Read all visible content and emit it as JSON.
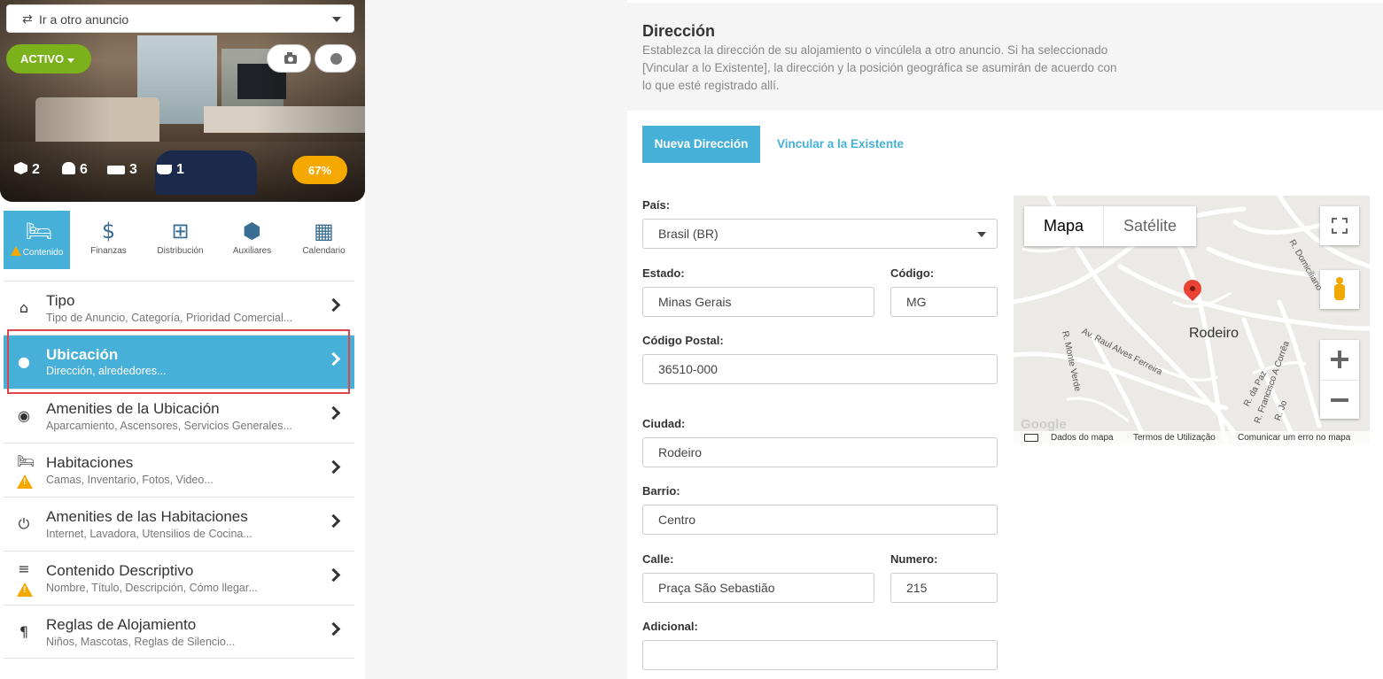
{
  "listing": {
    "goto_label": "Ir a otro anuncio",
    "status_label": "ACTIVO",
    "stats": {
      "rooms": "2",
      "guests": "6",
      "beds": "3",
      "baths": "1"
    },
    "completion": "67%"
  },
  "categories": [
    {
      "label": "Contenido",
      "icon": "bed-icon",
      "active": true,
      "warning": true
    },
    {
      "label": "Finanzas",
      "icon": "dollar-icon"
    },
    {
      "label": "Distribución",
      "icon": "sitemap-icon"
    },
    {
      "label": "Auxiliares",
      "icon": "cubes-icon"
    },
    {
      "label": "Calendario",
      "icon": "calendar-icon"
    }
  ],
  "menu": [
    {
      "title": "Tipo",
      "subtitle": "Tipo de Anuncio, Categoría, Prioridad Comercial...",
      "icon": "home-icon"
    },
    {
      "title": "Ubicación",
      "subtitle": "Dirección, alrededores...",
      "icon": "map-marker-icon",
      "active": true
    },
    {
      "title": "Amenities de la Ubicación",
      "subtitle": "Aparcamiento, Ascensores, Servicios Generales...",
      "icon": "dot-circle-icon"
    },
    {
      "title": "Habitaciones",
      "subtitle": "Camas, Inventario, Fotos, Video...",
      "icon": "bed-icon",
      "warning": true
    },
    {
      "title": "Amenities de las Habitaciones",
      "subtitle": "Internet, Lavadora, Utensilios de Cocina...",
      "icon": "plug-icon"
    },
    {
      "title": "Contenido Descriptivo",
      "subtitle": "Nombre, Título, Descripción, Cómo llegar...",
      "icon": "align-left-icon",
      "warning": true
    },
    {
      "title": "Reglas de Alojamiento",
      "subtitle": "Niños, Mascotas, Reglas de Silencio...",
      "icon": "paragraph-icon"
    }
  ],
  "address": {
    "title": "Dirección",
    "description": "Establezca la dirección de su alojamiento o vincúlela a otro anuncio. Si ha seleccionado [Vincular a lo Existente], la dirección y la posición geográfica se asumirán de acuerdo con lo que esté registrado allí.",
    "tab_new": "Nueva Dirección",
    "tab_link": "Vincular a la Existente",
    "fields": {
      "country_label": "País:",
      "country_value": "Brasil (BR)",
      "state_label": "Estado:",
      "state_value": "Minas Gerais",
      "code_label": "Código:",
      "code_value": "MG",
      "postal_label": "Código Postal:",
      "postal_value": "36510-000",
      "city_label": "Ciudad:",
      "city_value": "Rodeiro",
      "district_label": "Barrio:",
      "district_value": "Centro",
      "street_label": "Calle:",
      "street_value": "Praça São Sebastião",
      "number_label": "Numero:",
      "number_value": "215",
      "extra_label": "Adicional:",
      "extra_value": ""
    }
  },
  "map": {
    "type_map": "Mapa",
    "type_satellite": "Satélite",
    "place": "Rodeiro",
    "streets": [
      "R. Domiciliano",
      "Av. Raul Alves Ferreira",
      "R. Monte Verde",
      "R. da Paz",
      "R. Francisco A Corrêa",
      "R. Jo"
    ],
    "footer": {
      "data": "Dados do mapa",
      "terms": "Termos de Utilização",
      "report": "Comunicar um erro no mapa"
    },
    "logo": "Google"
  },
  "colors": {
    "accent": "#47b0d8",
    "active_green": "#7bb11a",
    "warning": "#f5a800",
    "highlight": "#e0454a",
    "pin": "#ea4335"
  }
}
